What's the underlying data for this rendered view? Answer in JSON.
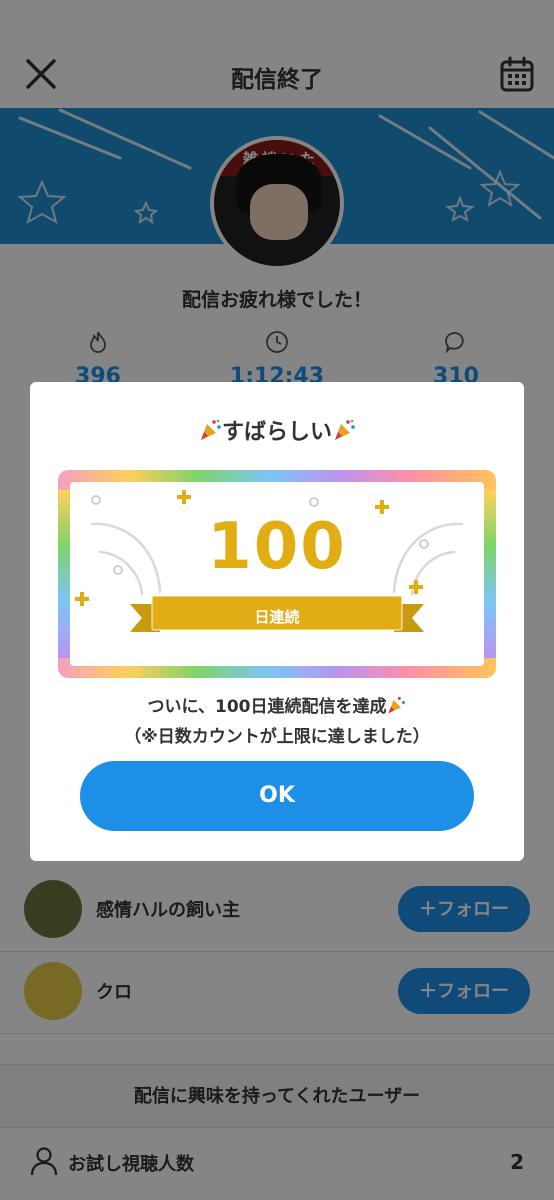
{
  "header": {
    "title": "配信終了",
    "close_icon": "close-icon",
    "calendar_icon": "calendar-icon"
  },
  "profile": {
    "avatar_text": "雑談いた"
  },
  "thanks": "配信お疲れ様でした！",
  "stats": [
    {
      "icon": "flame-icon",
      "value": "396"
    },
    {
      "icon": "clock-icon",
      "value": "1:12:43"
    },
    {
      "icon": "comment-icon",
      "value": "310"
    }
  ],
  "followers": [
    {
      "name": "感情ハルの飼い主",
      "button": "＋フォロー"
    },
    {
      "name": "クロ",
      "button": "＋フォロー"
    }
  ],
  "section_title": "配信に興味を持ってくれたユーザー",
  "trial": {
    "label": "お試し視聴人数",
    "count": "2"
  },
  "modal": {
    "title": "すばらしい",
    "badge_number": "100",
    "badge_label": "日連続",
    "message_line1": "ついに、100日連続配信を達成",
    "message_line2": "（※日数カウントが上限に達しました）",
    "ok_label": "OK"
  },
  "colors": {
    "accent": "#1d8fe6",
    "badge_gold": "#e1ad13",
    "banner": "#1f8fd0"
  }
}
